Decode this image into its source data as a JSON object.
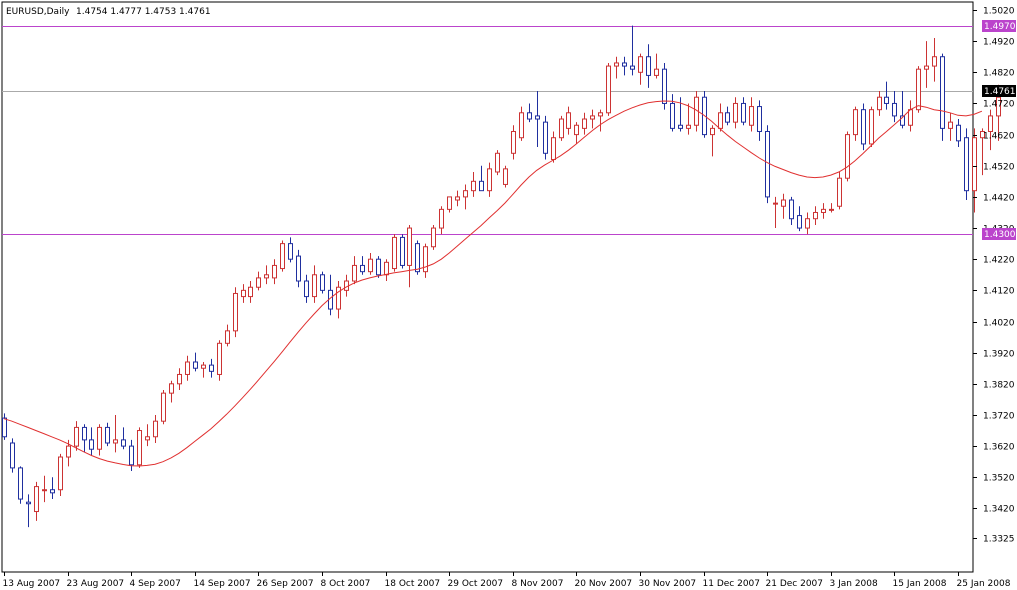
{
  "chart_data": {
    "type": "candlestick",
    "title": "EURUSD,Daily",
    "ohlc_header": "1.4754 1.4777 1.4753 1.4761",
    "ylim": [
      1.3325,
      1.502
    ],
    "y_ticks": [
      "1.5020",
      "1.4920",
      "1.4820",
      "1.4720",
      "1.4620",
      "1.4520",
      "1.4420",
      "1.4320",
      "1.4220",
      "1.4120",
      "1.4020",
      "1.3920",
      "1.3820",
      "1.3720",
      "1.3620",
      "1.3520",
      "1.3420",
      "1.3325"
    ],
    "x_tick_labels": [
      "13 Aug 2007",
      "23 Aug 2007",
      "4 Sep 2007",
      "14 Sep 2007",
      "26 Sep 2007",
      "8 Oct 2007",
      "18 Oct 2007",
      "29 Oct 2007",
      "8 Nov 2007",
      "20 Nov 2007",
      "30 Nov 2007",
      "11 Dec 2007",
      "21 Dec 2007",
      "3 Jan 2008",
      "15 Jan 2008",
      "25 Jan 2008"
    ],
    "x_tick_index": [
      0,
      8,
      16,
      24,
      32,
      40,
      48,
      56,
      64,
      72,
      80,
      88,
      96,
      104,
      112,
      120
    ],
    "bull_color": "#cc3333",
    "bear_color": "#1f2f9f",
    "ma_color": "#e03030",
    "level_color": "#bb44cc",
    "current_line_color": "#aaaaaa",
    "levels": [
      {
        "value": 1.497,
        "label": "1.4970"
      },
      {
        "value": 1.43,
        "label": "1.4300"
      }
    ],
    "current_price": {
      "value": 1.4761,
      "label": "1.4761"
    },
    "candles": [
      {
        "o": 1.371,
        "h": 1.3725,
        "l": 1.364,
        "c": 1.365
      },
      {
        "o": 1.363,
        "h": 1.3645,
        "l": 1.3535,
        "c": 1.355
      },
      {
        "o": 1.355,
        "h": 1.3555,
        "l": 1.3435,
        "c": 1.345
      },
      {
        "o": 1.344,
        "h": 1.3465,
        "l": 1.336,
        "c": 1.3435
      },
      {
        "o": 1.341,
        "h": 1.3505,
        "l": 1.338,
        "c": 1.349
      },
      {
        "o": 1.348,
        "h": 1.3525,
        "l": 1.344,
        "c": 1.348
      },
      {
        "o": 1.348,
        "h": 1.352,
        "l": 1.345,
        "c": 1.347
      },
      {
        "o": 1.348,
        "h": 1.3595,
        "l": 1.346,
        "c": 1.3585
      },
      {
        "o": 1.3585,
        "h": 1.364,
        "l": 1.3555,
        "c": 1.362
      },
      {
        "o": 1.362,
        "h": 1.37,
        "l": 1.3605,
        "c": 1.368
      },
      {
        "o": 1.368,
        "h": 1.369,
        "l": 1.36,
        "c": 1.364
      },
      {
        "o": 1.364,
        "h": 1.368,
        "l": 1.359,
        "c": 1.361
      },
      {
        "o": 1.361,
        "h": 1.369,
        "l": 1.359,
        "c": 1.368
      },
      {
        "o": 1.368,
        "h": 1.3695,
        "l": 1.362,
        "c": 1.363
      },
      {
        "o": 1.363,
        "h": 1.372,
        "l": 1.36,
        "c": 1.364
      },
      {
        "o": 1.364,
        "h": 1.368,
        "l": 1.361,
        "c": 1.362
      },
      {
        "o": 1.362,
        "h": 1.364,
        "l": 1.354,
        "c": 1.356
      },
      {
        "o": 1.356,
        "h": 1.368,
        "l": 1.355,
        "c": 1.367
      },
      {
        "o": 1.364,
        "h": 1.369,
        "l": 1.362,
        "c": 1.365
      },
      {
        "o": 1.365,
        "h": 1.372,
        "l": 1.363,
        "c": 1.37
      },
      {
        "o": 1.37,
        "h": 1.38,
        "l": 1.369,
        "c": 1.379
      },
      {
        "o": 1.379,
        "h": 1.383,
        "l": 1.376,
        "c": 1.382
      },
      {
        "o": 1.382,
        "h": 1.387,
        "l": 1.38,
        "c": 1.385
      },
      {
        "o": 1.385,
        "h": 1.391,
        "l": 1.383,
        "c": 1.389
      },
      {
        "o": 1.389,
        "h": 1.392,
        "l": 1.386,
        "c": 1.387
      },
      {
        "o": 1.387,
        "h": 1.389,
        "l": 1.384,
        "c": 1.388
      },
      {
        "o": 1.388,
        "h": 1.39,
        "l": 1.384,
        "c": 1.386
      },
      {
        "o": 1.385,
        "h": 1.396,
        "l": 1.383,
        "c": 1.395
      },
      {
        "o": 1.395,
        "h": 1.401,
        "l": 1.394,
        "c": 1.399
      },
      {
        "o": 1.399,
        "h": 1.413,
        "l": 1.397,
        "c": 1.411
      },
      {
        "o": 1.41,
        "h": 1.414,
        "l": 1.408,
        "c": 1.412
      },
      {
        "o": 1.41,
        "h": 1.415,
        "l": 1.408,
        "c": 1.413
      },
      {
        "o": 1.413,
        "h": 1.418,
        "l": 1.412,
        "c": 1.416
      },
      {
        "o": 1.416,
        "h": 1.42,
        "l": 1.414,
        "c": 1.417
      },
      {
        "o": 1.416,
        "h": 1.422,
        "l": 1.414,
        "c": 1.42
      },
      {
        "o": 1.419,
        "h": 1.428,
        "l": 1.418,
        "c": 1.427
      },
      {
        "o": 1.427,
        "h": 1.429,
        "l": 1.421,
        "c": 1.422
      },
      {
        "o": 1.423,
        "h": 1.425,
        "l": 1.413,
        "c": 1.415
      },
      {
        "o": 1.415,
        "h": 1.417,
        "l": 1.408,
        "c": 1.41
      },
      {
        "o": 1.41,
        "h": 1.42,
        "l": 1.408,
        "c": 1.417
      },
      {
        "o": 1.417,
        "h": 1.418,
        "l": 1.411,
        "c": 1.412
      },
      {
        "o": 1.412,
        "h": 1.417,
        "l": 1.404,
        "c": 1.406
      },
      {
        "o": 1.406,
        "h": 1.415,
        "l": 1.403,
        "c": 1.413
      },
      {
        "o": 1.412,
        "h": 1.417,
        "l": 1.41,
        "c": 1.415
      },
      {
        "o": 1.415,
        "h": 1.423,
        "l": 1.414,
        "c": 1.42
      },
      {
        "o": 1.42,
        "h": 1.423,
        "l": 1.417,
        "c": 1.418
      },
      {
        "o": 1.418,
        "h": 1.424,
        "l": 1.417,
        "c": 1.422
      },
      {
        "o": 1.422,
        "h": 1.423,
        "l": 1.416,
        "c": 1.417
      },
      {
        "o": 1.417,
        "h": 1.422,
        "l": 1.415,
        "c": 1.421
      },
      {
        "o": 1.419,
        "h": 1.43,
        "l": 1.418,
        "c": 1.429
      },
      {
        "o": 1.429,
        "h": 1.43,
        "l": 1.419,
        "c": 1.42
      },
      {
        "o": 1.42,
        "h": 1.433,
        "l": 1.413,
        "c": 1.432
      },
      {
        "o": 1.427,
        "h": 1.428,
        "l": 1.417,
        "c": 1.418
      },
      {
        "o": 1.418,
        "h": 1.427,
        "l": 1.416,
        "c": 1.426
      },
      {
        "o": 1.426,
        "h": 1.433,
        "l": 1.425,
        "c": 1.432
      },
      {
        "o": 1.432,
        "h": 1.439,
        "l": 1.43,
        "c": 1.438
      },
      {
        "o": 1.438,
        "h": 1.442,
        "l": 1.437,
        "c": 1.442
      },
      {
        "o": 1.441,
        "h": 1.444,
        "l": 1.439,
        "c": 1.442
      },
      {
        "o": 1.442,
        "h": 1.446,
        "l": 1.438,
        "c": 1.444
      },
      {
        "o": 1.444,
        "h": 1.45,
        "l": 1.442,
        "c": 1.447
      },
      {
        "o": 1.447,
        "h": 1.452,
        "l": 1.444,
        "c": 1.444
      },
      {
        "o": 1.444,
        "h": 1.453,
        "l": 1.442,
        "c": 1.451
      },
      {
        "o": 1.45,
        "h": 1.457,
        "l": 1.449,
        "c": 1.456
      },
      {
        "o": 1.446,
        "h": 1.452,
        "l": 1.445,
        "c": 1.451
      },
      {
        "o": 1.456,
        "h": 1.465,
        "l": 1.454,
        "c": 1.463
      },
      {
        "o": 1.461,
        "h": 1.471,
        "l": 1.46,
        "c": 1.469
      },
      {
        "o": 1.469,
        "h": 1.472,
        "l": 1.466,
        "c": 1.467
      },
      {
        "o": 1.468,
        "h": 1.476,
        "l": 1.458,
        "c": 1.467
      },
      {
        "o": 1.466,
        "h": 1.468,
        "l": 1.454,
        "c": 1.456
      },
      {
        "o": 1.454,
        "h": 1.463,
        "l": 1.453,
        "c": 1.461
      },
      {
        "o": 1.461,
        "h": 1.468,
        "l": 1.46,
        "c": 1.467
      },
      {
        "o": 1.464,
        "h": 1.471,
        "l": 1.462,
        "c": 1.469
      },
      {
        "o": 1.462,
        "h": 1.466,
        "l": 1.459,
        "c": 1.465
      },
      {
        "o": 1.464,
        "h": 1.469,
        "l": 1.462,
        "c": 1.467
      },
      {
        "o": 1.467,
        "h": 1.47,
        "l": 1.464,
        "c": 1.468
      },
      {
        "o": 1.468,
        "h": 1.47,
        "l": 1.463,
        "c": 1.469
      },
      {
        "o": 1.469,
        "h": 1.485,
        "l": 1.468,
        "c": 1.484
      },
      {
        "o": 1.484,
        "h": 1.487,
        "l": 1.48,
        "c": 1.485
      },
      {
        "o": 1.485,
        "h": 1.487,
        "l": 1.481,
        "c": 1.484
      },
      {
        "o": 1.484,
        "h": 1.497,
        "l": 1.481,
        "c": 1.483
      },
      {
        "o": 1.482,
        "h": 1.488,
        "l": 1.478,
        "c": 1.487
      },
      {
        "o": 1.487,
        "h": 1.491,
        "l": 1.477,
        "c": 1.481
      },
      {
        "o": 1.481,
        "h": 1.488,
        "l": 1.48,
        "c": 1.483
      },
      {
        "o": 1.483,
        "h": 1.485,
        "l": 1.47,
        "c": 1.472
      },
      {
        "o": 1.472,
        "h": 1.475,
        "l": 1.463,
        "c": 1.464
      },
      {
        "o": 1.465,
        "h": 1.474,
        "l": 1.463,
        "c": 1.464
      },
      {
        "o": 1.464,
        "h": 1.472,
        "l": 1.462,
        "c": 1.465
      },
      {
        "o": 1.465,
        "h": 1.476,
        "l": 1.463,
        "c": 1.474
      },
      {
        "o": 1.474,
        "h": 1.476,
        "l": 1.461,
        "c": 1.462
      },
      {
        "o": 1.462,
        "h": 1.465,
        "l": 1.455,
        "c": 1.464
      },
      {
        "o": 1.464,
        "h": 1.472,
        "l": 1.463,
        "c": 1.469
      },
      {
        "o": 1.469,
        "h": 1.471,
        "l": 1.465,
        "c": 1.466
      },
      {
        "o": 1.466,
        "h": 1.474,
        "l": 1.464,
        "c": 1.472
      },
      {
        "o": 1.472,
        "h": 1.474,
        "l": 1.465,
        "c": 1.466
      },
      {
        "o": 1.465,
        "h": 1.474,
        "l": 1.463,
        "c": 1.471
      },
      {
        "o": 1.471,
        "h": 1.473,
        "l": 1.46,
        "c": 1.463
      },
      {
        "o": 1.463,
        "h": 1.465,
        "l": 1.44,
        "c": 1.442
      },
      {
        "o": 1.44,
        "h": 1.442,
        "l": 1.432,
        "c": 1.44
      },
      {
        "o": 1.439,
        "h": 1.443,
        "l": 1.435,
        "c": 1.441
      },
      {
        "o": 1.441,
        "h": 1.442,
        "l": 1.433,
        "c": 1.435
      },
      {
        "o": 1.436,
        "h": 1.439,
        "l": 1.431,
        "c": 1.432
      },
      {
        "o": 1.432,
        "h": 1.437,
        "l": 1.43,
        "c": 1.435
      },
      {
        "o": 1.435,
        "h": 1.439,
        "l": 1.433,
        "c": 1.437
      },
      {
        "o": 1.437,
        "h": 1.44,
        "l": 1.435,
        "c": 1.438
      },
      {
        "o": 1.438,
        "h": 1.44,
        "l": 1.437,
        "c": 1.438
      },
      {
        "o": 1.439,
        "h": 1.45,
        "l": 1.438,
        "c": 1.448
      },
      {
        "o": 1.448,
        "h": 1.463,
        "l": 1.447,
        "c": 1.462
      },
      {
        "o": 1.462,
        "h": 1.471,
        "l": 1.46,
        "c": 1.47
      },
      {
        "o": 1.47,
        "h": 1.472,
        "l": 1.457,
        "c": 1.459
      },
      {
        "o": 1.459,
        "h": 1.471,
        "l": 1.458,
        "c": 1.47
      },
      {
        "o": 1.47,
        "h": 1.476,
        "l": 1.468,
        "c": 1.474
      },
      {
        "o": 1.474,
        "h": 1.479,
        "l": 1.47,
        "c": 1.472
      },
      {
        "o": 1.472,
        "h": 1.476,
        "l": 1.466,
        "c": 1.468
      },
      {
        "o": 1.468,
        "h": 1.476,
        "l": 1.464,
        "c": 1.465
      },
      {
        "o": 1.465,
        "h": 1.473,
        "l": 1.463,
        "c": 1.47
      },
      {
        "o": 1.47,
        "h": 1.484,
        "l": 1.469,
        "c": 1.483
      },
      {
        "o": 1.483,
        "h": 1.492,
        "l": 1.477,
        "c": 1.484
      },
      {
        "o": 1.484,
        "h": 1.493,
        "l": 1.479,
        "c": 1.487
      },
      {
        "o": 1.487,
        "h": 1.488,
        "l": 1.46,
        "c": 1.464
      },
      {
        "o": 1.464,
        "h": 1.469,
        "l": 1.46,
        "c": 1.466
      },
      {
        "o": 1.465,
        "h": 1.467,
        "l": 1.458,
        "c": 1.46
      },
      {
        "o": 1.461,
        "h": 1.464,
        "l": 1.441,
        "c": 1.444
      },
      {
        "o": 1.444,
        "h": 1.464,
        "l": 1.437,
        "c": 1.461
      },
      {
        "o": 1.461,
        "h": 1.464,
        "l": 1.449,
        "c": 1.463
      },
      {
        "o": 1.463,
        "h": 1.47,
        "l": 1.457,
        "c": 1.468
      },
      {
        "o": 1.468,
        "h": 1.478,
        "l": 1.46,
        "c": 1.474
      },
      {
        "o": 1.4754,
        "h": 1.4777,
        "l": 1.4753,
        "c": 1.4761
      }
    ],
    "moving_average": {
      "period": 20,
      "values": [
        1.3708,
        1.37,
        1.369,
        1.368,
        1.367,
        1.366,
        1.365,
        1.364,
        1.3628,
        1.3615,
        1.3602,
        1.359,
        1.358,
        1.3572,
        1.3566,
        1.3561,
        1.3557,
        1.3556,
        1.3558,
        1.3562,
        1.357,
        1.3582,
        1.3597,
        1.3615,
        1.3635,
        1.3655,
        1.3675,
        1.3698,
        1.3722,
        1.3748,
        1.3775,
        1.3803,
        1.3832,
        1.3862,
        1.3892,
        1.3923,
        1.3955,
        1.3986,
        1.4016,
        1.4044,
        1.4071,
        1.4094,
        1.4114,
        1.413,
        1.4143,
        1.4153,
        1.416,
        1.4166,
        1.4171,
        1.4176,
        1.418,
        1.4184,
        1.4188,
        1.4195,
        1.4205,
        1.422,
        1.424,
        1.4262,
        1.4284,
        1.4306,
        1.4328,
        1.4352,
        1.4375,
        1.44,
        1.4428,
        1.4457,
        1.4483,
        1.4505,
        1.4522,
        1.4537,
        1.4552,
        1.457,
        1.459,
        1.4612,
        1.4633,
        1.4652,
        1.4668,
        1.4682,
        1.4695,
        1.4706,
        1.4715,
        1.4722,
        1.4726,
        1.4728,
        1.4727,
        1.4722,
        1.4713,
        1.47,
        1.4683,
        1.4663,
        1.464,
        1.4618,
        1.4598,
        1.458,
        1.4562,
        1.4545,
        1.453,
        1.4518,
        1.4508,
        1.4498,
        1.449,
        1.4484,
        1.4482,
        1.4484,
        1.449,
        1.45,
        1.4515,
        1.4535,
        1.4558,
        1.4583,
        1.4608,
        1.463,
        1.4652,
        1.4675,
        1.47,
        1.4713,
        1.4708,
        1.47,
        1.4696,
        1.469,
        1.4682,
        1.468,
        1.4685,
        1.4695
      ]
    }
  }
}
